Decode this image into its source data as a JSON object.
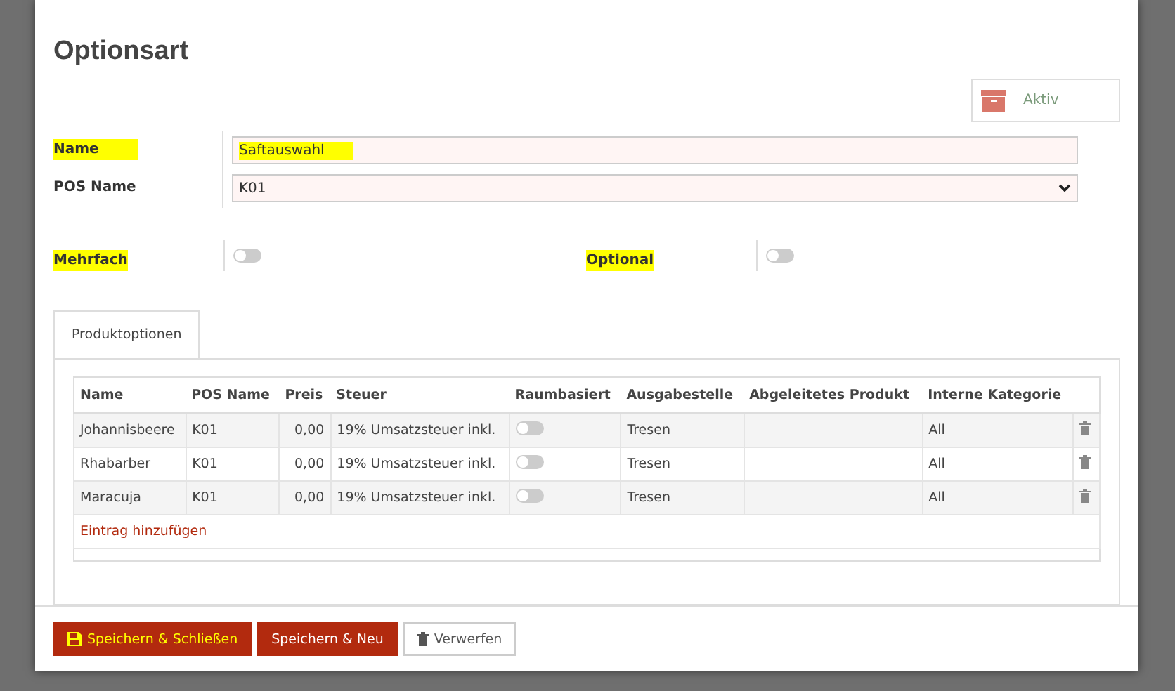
{
  "dialog": {
    "title": "Optionsart",
    "active_button": "Aktiv"
  },
  "fields": [
    {
      "label": "Name",
      "highlighted": true,
      "kind": "text",
      "value": "Saftauswahl",
      "value_highlighted": true
    },
    {
      "label": "POS Name",
      "highlighted": false,
      "kind": "select",
      "value": "K01",
      "value_highlighted": false
    }
  ],
  "toggles": [
    {
      "label": "Mehrfach",
      "highlighted": true,
      "on": false
    },
    {
      "label": "Optional",
      "highlighted": true,
      "on": false
    }
  ],
  "tabs": [
    {
      "label": "Produktoptionen",
      "selected": true
    }
  ],
  "table": {
    "columns": [
      "Name",
      "POS Name",
      "Preis",
      "Steuer",
      "Raumbasiert",
      "Ausgabestelle",
      "Abgeleitetes Produkt",
      "Interne Kategorie"
    ],
    "rows": [
      {
        "name": "Johannisbeere",
        "pos_name": "K01",
        "price": "0,00",
        "tax": "19% Umsatzsteuer inkl.",
        "room_based": false,
        "outlet": "Tresen",
        "category": "All"
      },
      {
        "name": "Rhabarber",
        "pos_name": "K01",
        "price": "0,00",
        "tax": "19% Umsatzsteuer inkl.",
        "room_based": false,
        "outlet": "Tresen",
        "category": "All"
      },
      {
        "name": "Maracuja",
        "pos_name": "K01",
        "price": "0,00",
        "tax": "19% Umsatzsteuer inkl.",
        "room_based": false,
        "outlet": "Tresen",
        "category": "All"
      }
    ],
    "add_link": "Eintrag hinzufügen"
  },
  "buttons": [
    {
      "label": "Speichern & Schließen",
      "kind": "primary",
      "highlighted": true
    },
    {
      "label": "Speichern & Neu",
      "kind": "primary",
      "highlighted": false
    },
    {
      "label": "Verwerfen",
      "kind": "secondary",
      "highlighted": false
    }
  ]
}
